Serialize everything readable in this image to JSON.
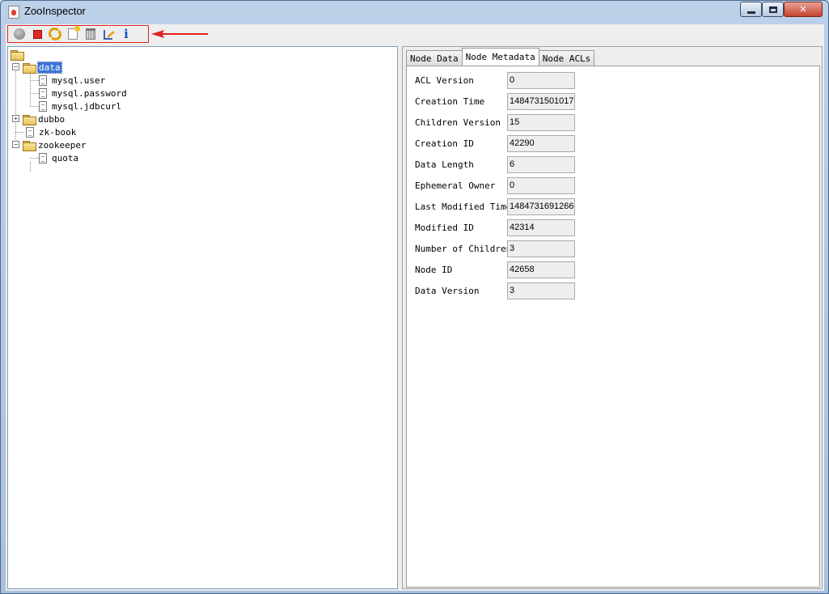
{
  "window": {
    "title": "ZooInspector",
    "controls": {
      "minimize": "",
      "maximize": "",
      "close": "✕"
    }
  },
  "toolbar": {
    "buttons": [
      {
        "id": "connect",
        "icon": "connect-icon"
      },
      {
        "id": "disconnect",
        "icon": "disconnect-icon"
      },
      {
        "id": "refresh",
        "icon": "refresh-icon"
      },
      {
        "id": "add-node",
        "icon": "add-node-icon"
      },
      {
        "id": "delete-node",
        "icon": "delete-node-icon"
      },
      {
        "id": "node-viewers",
        "icon": "edit-icon"
      },
      {
        "id": "about",
        "icon": "info-icon",
        "glyph": "i"
      }
    ],
    "highlight_color": "#e02424"
  },
  "tree": {
    "nodes": [
      {
        "label": "data",
        "type": "folder",
        "expanded": true,
        "selected": true
      },
      {
        "label": "mysql.user",
        "type": "file"
      },
      {
        "label": "mysql.password",
        "type": "file"
      },
      {
        "label": "mysql.jdbcurl",
        "type": "file"
      },
      {
        "label": "dubbo",
        "type": "folder",
        "expanded": false
      },
      {
        "label": "zk-book",
        "type": "file"
      },
      {
        "label": "zookeeper",
        "type": "folder",
        "expanded": true
      },
      {
        "label": "quota",
        "type": "file"
      }
    ],
    "expand_glyph": "+",
    "collapse_glyph": "−"
  },
  "tabs": [
    {
      "label": "Node Data",
      "active": false
    },
    {
      "label": "Node Metadata",
      "active": true
    },
    {
      "label": "Node ACLs",
      "active": false
    }
  ],
  "metadata": [
    {
      "label": "ACL Version",
      "value": "0"
    },
    {
      "label": "Creation Time",
      "value": "1484731501017"
    },
    {
      "label": "Children Version",
      "value": "15"
    },
    {
      "label": "Creation ID",
      "value": "42290"
    },
    {
      "label": "Data Length",
      "value": "6"
    },
    {
      "label": "Ephemeral Owner",
      "value": "0"
    },
    {
      "label": "Last Modified Time",
      "value": "1484731691266"
    },
    {
      "label": "Modified ID",
      "value": "42314"
    },
    {
      "label": "Number of Children",
      "value": "3"
    },
    {
      "label": "Node ID",
      "value": "42658"
    },
    {
      "label": "Data Version",
      "value": "3"
    }
  ]
}
